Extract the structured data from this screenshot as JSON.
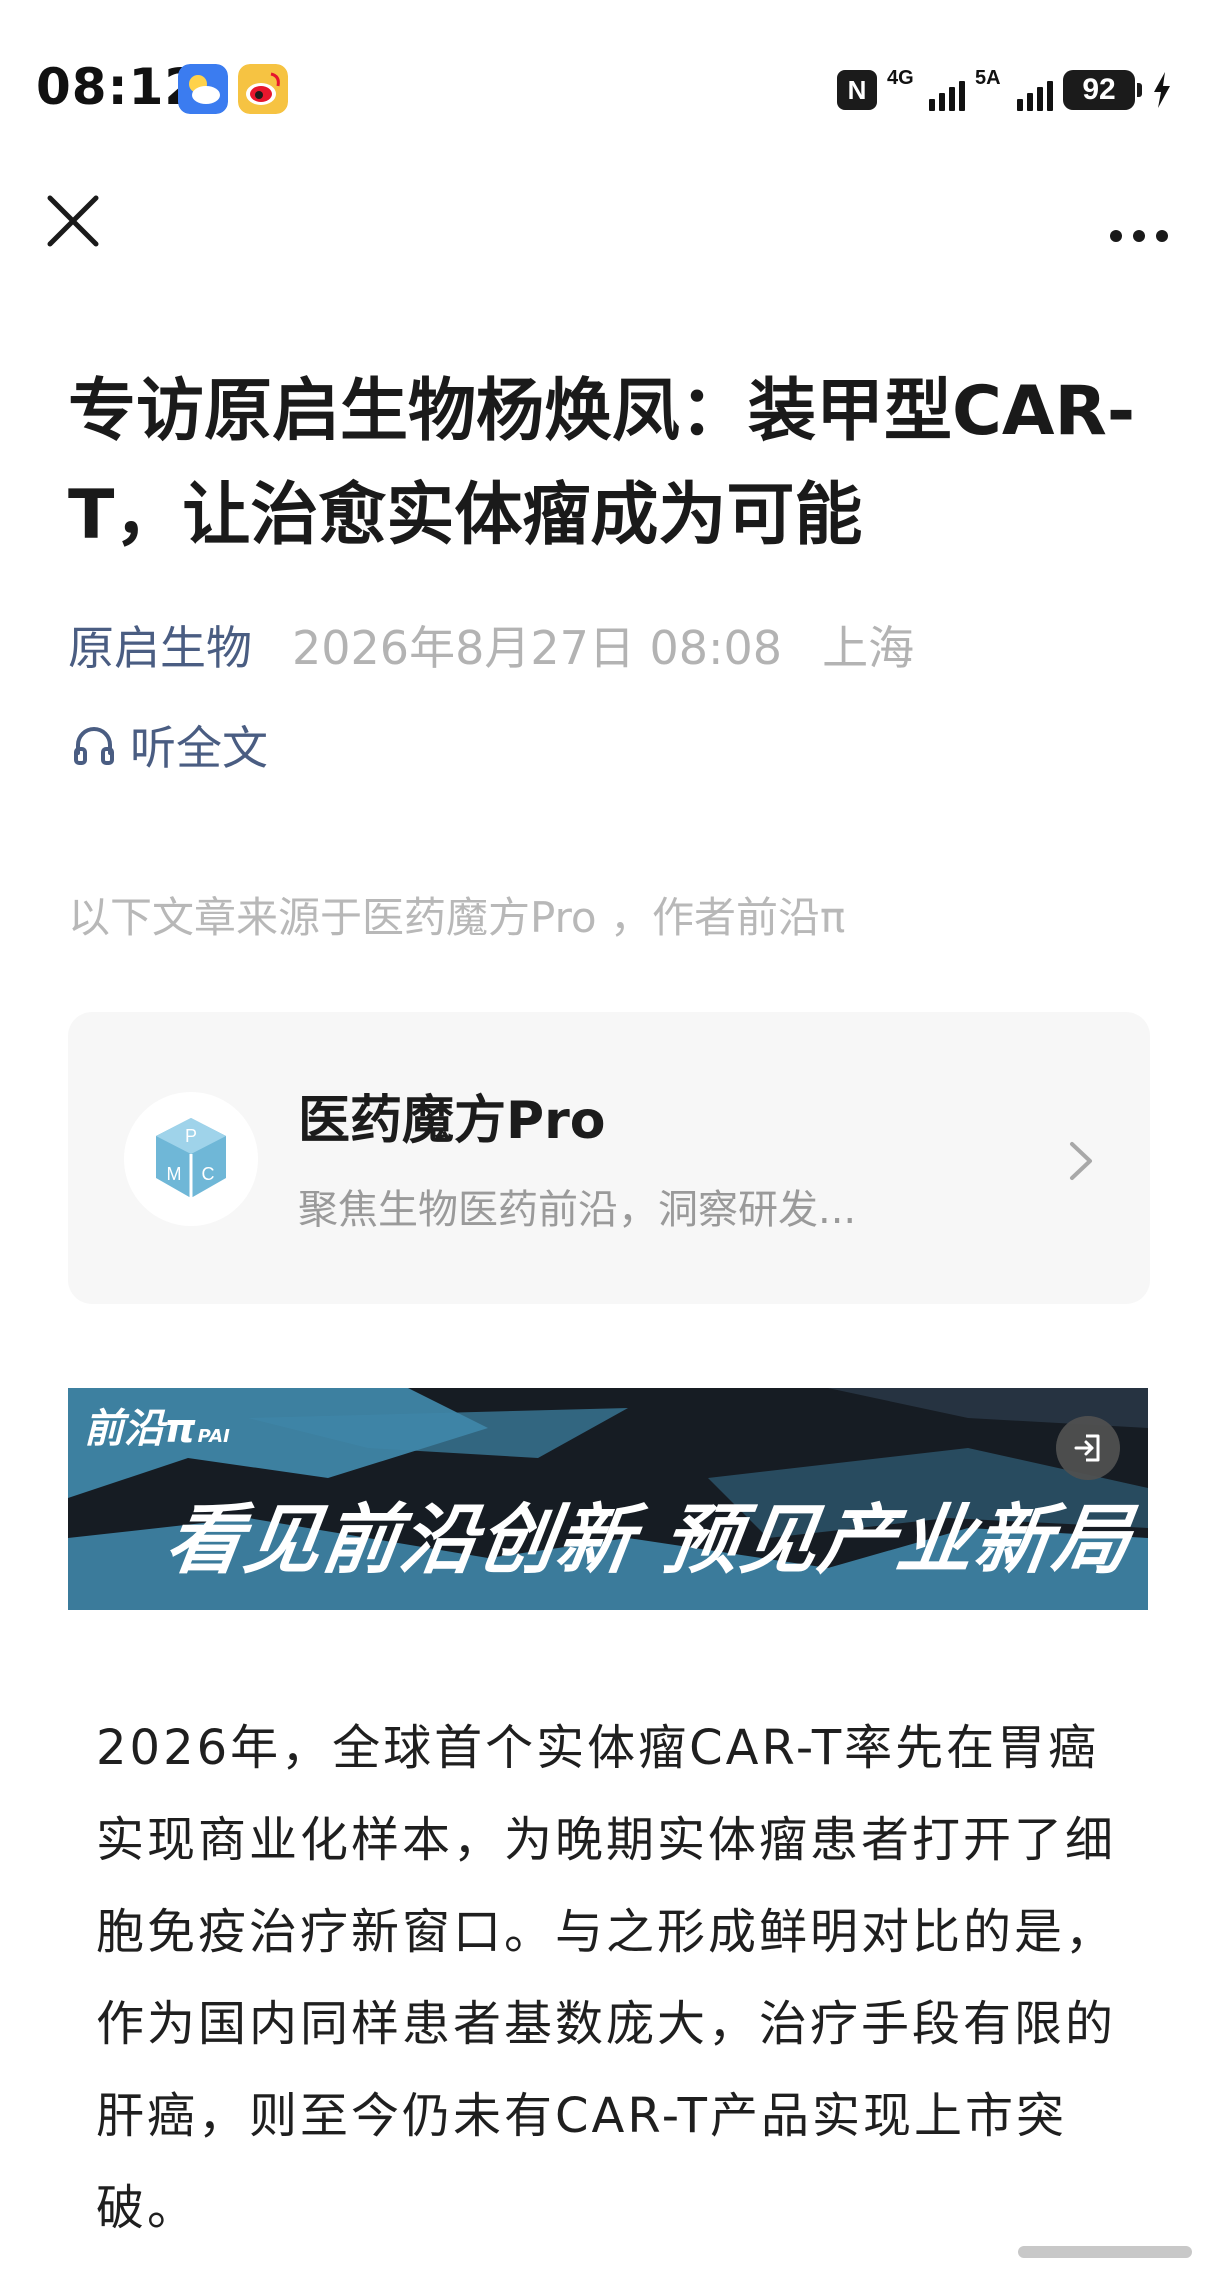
{
  "status_bar": {
    "time": "08:12",
    "nfc_label": "N",
    "signal_1_label": "4G",
    "signal_2_label": "5A",
    "battery_level": "92"
  },
  "topbar": {
    "close_icon": "close-icon",
    "more_icon": "more-dots-icon"
  },
  "article": {
    "title": "专访原启生物杨焕凤：装甲型CAR-T，让治愈实体瘤成为可能",
    "source": "原启生物",
    "date": "2026年8月27日 08:08",
    "location": "上海",
    "listen_label": "听全文",
    "source_note": "以下文章来源于医药魔方Pro ，作者前沿π"
  },
  "account_card": {
    "name": "医药魔方Pro",
    "description": "聚焦生物医药前沿，洞察研发...",
    "avatar_letters": [
      "P",
      "M",
      "C"
    ]
  },
  "banner": {
    "logo": "前沿π",
    "logo_sub": "PAI",
    "slogan": "看见前沿创新 预见产业新局"
  },
  "body": {
    "paragraph": "2026年，全球首个实体瘤CAR-T率先在胃癌实现商业化样本，为晚期实体瘤患者打开了细胞免疫治疗新窗口。与之形成鲜明对比的是，作为国内同样患者基数庞大，治疗手段有限的肝癌，则至今仍未有CAR-T产品实现上市突破。"
  },
  "colors": {
    "accent_link": "#4a5d82",
    "muted_text": "#b3b3b3",
    "banner_blue": "#3f86a8"
  }
}
